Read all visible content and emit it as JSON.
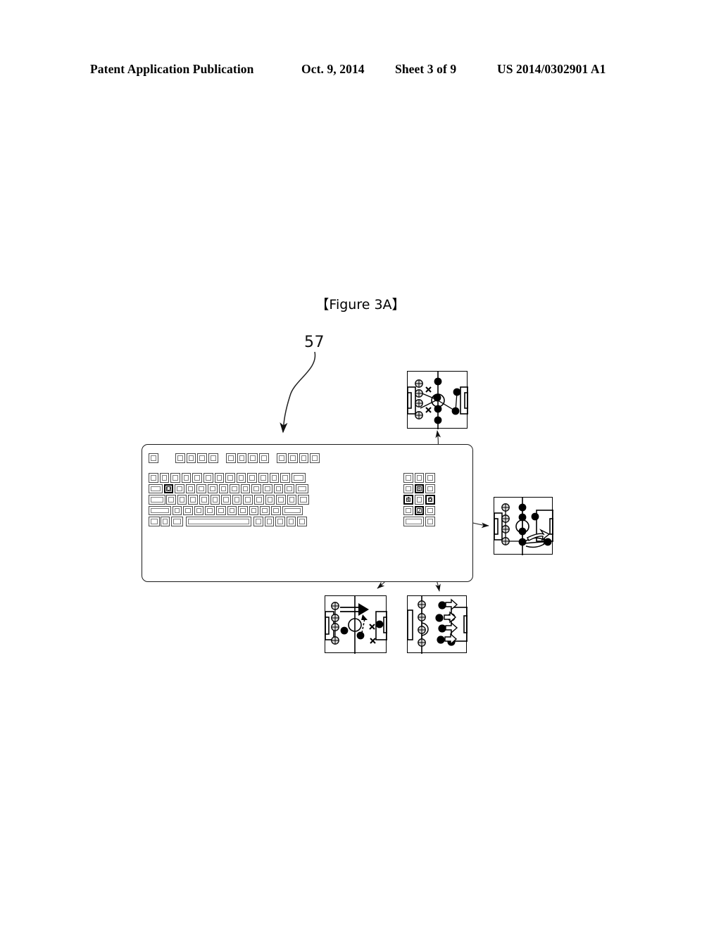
{
  "header": {
    "publication": "Patent Application Publication",
    "date": "Oct. 9, 2014",
    "sheet": "Sheet 3 of 9",
    "number": "US 2014/0302901 A1"
  },
  "figure": {
    "label": "【Figure 3A】",
    "reference_numeral": "57"
  },
  "keyboard": {
    "name": "computer-keyboard",
    "highlighted_keys": [
      "Q",
      "8",
      "4",
      "6",
      "2"
    ],
    "keycaps": {
      "q": "Q",
      "num8": "8",
      "num4": "4",
      "num6": "6",
      "num2": "2"
    },
    "rows": {
      "function_row_groups": [
        1,
        4,
        4,
        4
      ],
      "row1_keys": 14,
      "row2_keys": 14,
      "row3_keys": 13,
      "row4_keys": 12,
      "row5_keys": 10,
      "numpad_columns": 3,
      "numpad_rows": 5
    }
  },
  "callouts": [
    {
      "id": "callout-top",
      "name": "tactics-view-up",
      "source_key": "8",
      "description": "soccer pitch formation view"
    },
    {
      "id": "callout-right",
      "name": "tactics-view-right",
      "source_key": "6",
      "description": "soccer pitch formation view"
    },
    {
      "id": "callout-bl",
      "name": "tactics-view-left",
      "source_key": "4",
      "description": "soccer pitch formation view"
    },
    {
      "id": "callout-br",
      "name": "tactics-view-down",
      "source_key": "2",
      "description": "soccer pitch formation view"
    }
  ],
  "colors": {
    "ink": "#000000",
    "paper": "#ffffff",
    "key_outline": "#4a4a4a",
    "key_bevel": "#7d7d7d"
  }
}
